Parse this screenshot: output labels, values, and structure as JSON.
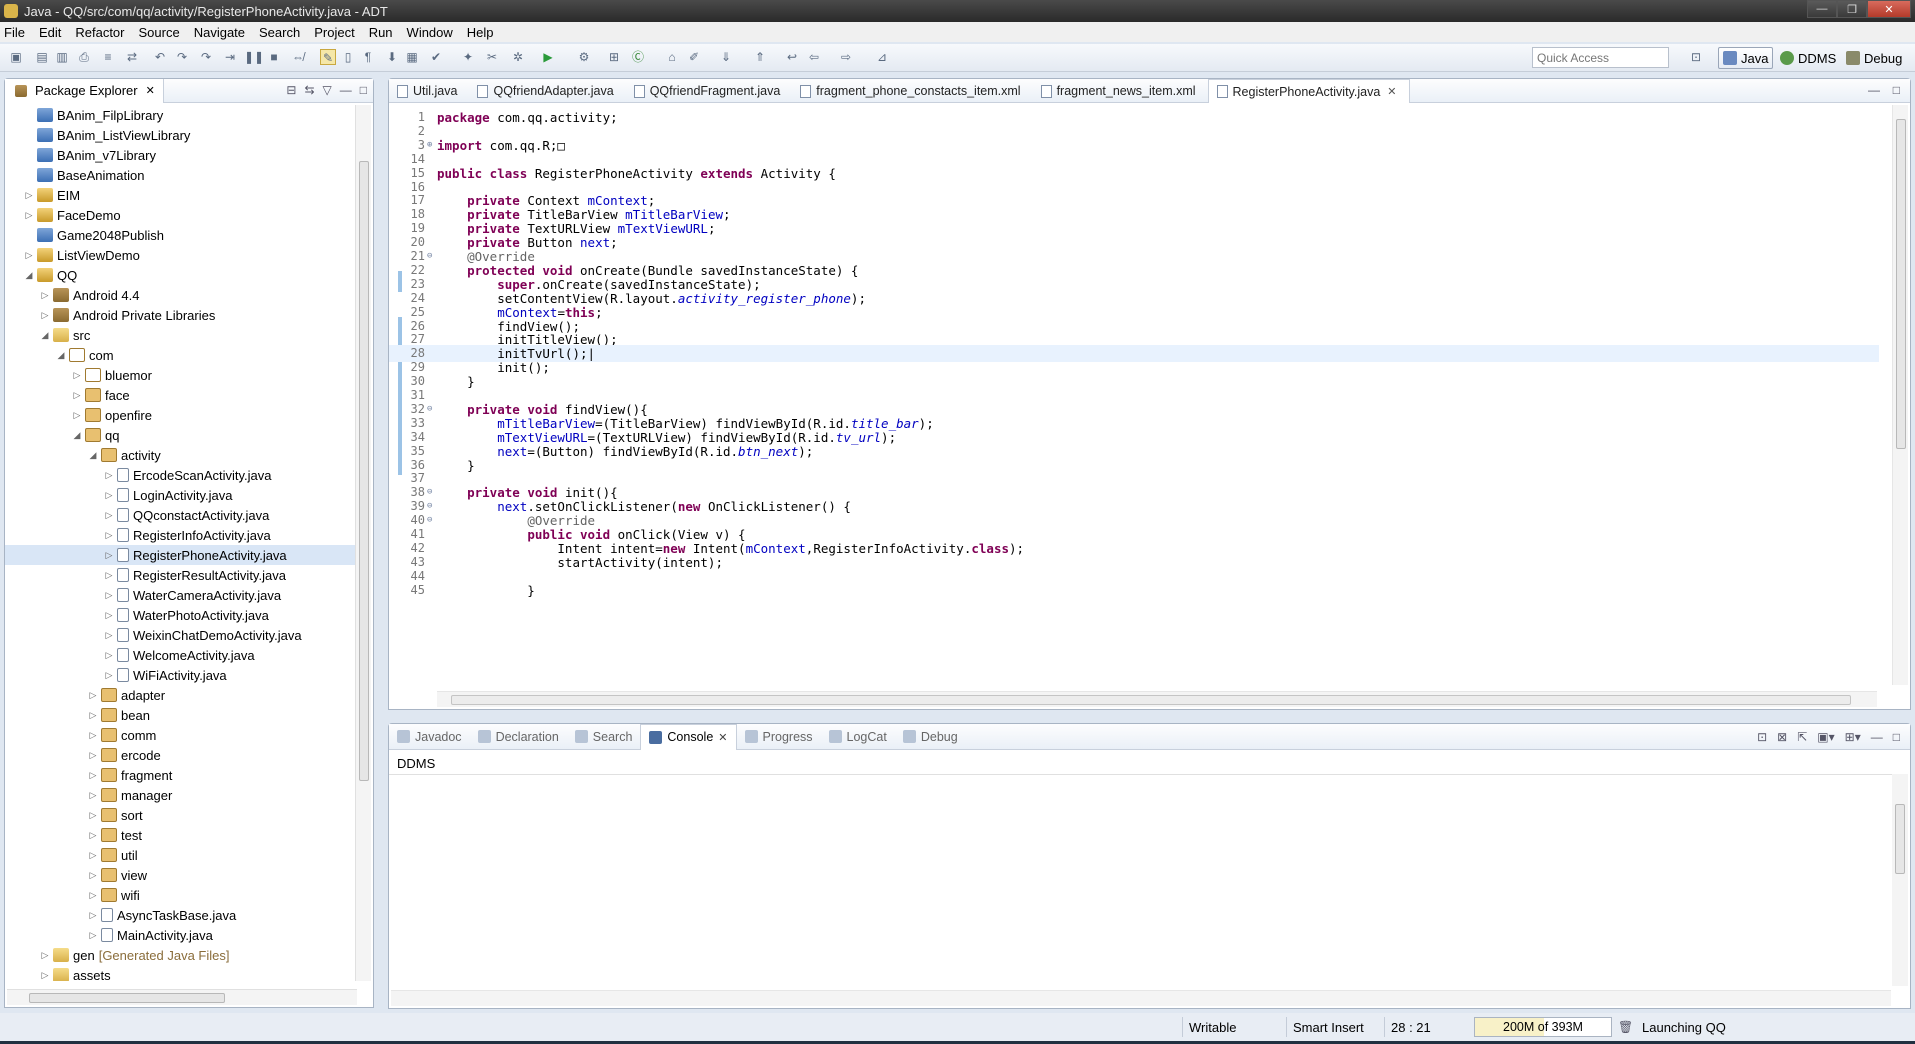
{
  "window": {
    "title": "Java - QQ/src/com/qq/activity/RegisterPhoneActivity.java - ADT",
    "minimize": "—",
    "maximize": "❐",
    "close": "✕"
  },
  "menu": [
    "File",
    "Edit",
    "Refactor",
    "Source",
    "Navigate",
    "Search",
    "Project",
    "Run",
    "Window",
    "Help"
  ],
  "toolbar": {
    "quick_access_placeholder": "Quick Access",
    "perspectives": [
      {
        "label": "Java",
        "active": true
      },
      {
        "label": "DDMS",
        "active": false
      },
      {
        "label": "Debug",
        "active": false
      }
    ]
  },
  "package_explorer": {
    "tab_label": "Package Explorer",
    "items": [
      {
        "label": "BAnim_FilpLibrary",
        "depth": 0,
        "icon": "project",
        "twisty": ""
      },
      {
        "label": "BAnim_ListViewLibrary",
        "depth": 0,
        "icon": "project",
        "twisty": ""
      },
      {
        "label": "BAnim_v7Library",
        "depth": 0,
        "icon": "project",
        "twisty": ""
      },
      {
        "label": "BaseAnimation",
        "depth": 0,
        "icon": "project",
        "twisty": ""
      },
      {
        "label": "EIM",
        "depth": 0,
        "icon": "projx",
        "twisty": "▷"
      },
      {
        "label": "FaceDemo",
        "depth": 0,
        "icon": "projx",
        "twisty": "▷"
      },
      {
        "label": "Game2048Publish",
        "depth": 0,
        "icon": "project",
        "twisty": ""
      },
      {
        "label": "ListViewDemo",
        "depth": 0,
        "icon": "projx",
        "twisty": "▷"
      },
      {
        "label": "QQ",
        "depth": 0,
        "icon": "projx",
        "twisty": "◢"
      },
      {
        "label": "Android 4.4",
        "depth": 1,
        "icon": "lib",
        "twisty": "▷"
      },
      {
        "label": "Android Private Libraries",
        "depth": 1,
        "icon": "lib",
        "twisty": "▷"
      },
      {
        "label": "src",
        "depth": 1,
        "icon": "folder",
        "twisty": "◢"
      },
      {
        "label": "com",
        "depth": 2,
        "icon": "pkgempty",
        "twisty": "◢"
      },
      {
        "label": "bluemor",
        "depth": 3,
        "icon": "pkgempty",
        "twisty": "▷"
      },
      {
        "label": "face",
        "depth": 3,
        "icon": "pkg",
        "twisty": "▷"
      },
      {
        "label": "openfire",
        "depth": 3,
        "icon": "pkg",
        "twisty": "▷"
      },
      {
        "label": "qq",
        "depth": 3,
        "icon": "pkg",
        "twisty": "◢"
      },
      {
        "label": "activity",
        "depth": 4,
        "icon": "pkg",
        "twisty": "◢"
      },
      {
        "label": "ErcodeScanActivity.java",
        "depth": 5,
        "icon": "java",
        "twisty": "▷"
      },
      {
        "label": "LoginActivity.java",
        "depth": 5,
        "icon": "java",
        "twisty": "▷"
      },
      {
        "label": "QQconstactActivity.java",
        "depth": 5,
        "icon": "java",
        "twisty": "▷"
      },
      {
        "label": "RegisterInfoActivity.java",
        "depth": 5,
        "icon": "java",
        "twisty": "▷"
      },
      {
        "label": "RegisterPhoneActivity.java",
        "depth": 5,
        "icon": "java",
        "twisty": "▷",
        "selected": true
      },
      {
        "label": "RegisterResultActivity.java",
        "depth": 5,
        "icon": "java",
        "twisty": "▷"
      },
      {
        "label": "WaterCameraActivity.java",
        "depth": 5,
        "icon": "java",
        "twisty": "▷"
      },
      {
        "label": "WaterPhotoActivity.java",
        "depth": 5,
        "icon": "java",
        "twisty": "▷"
      },
      {
        "label": "WeixinChatDemoActivity.java",
        "depth": 5,
        "icon": "java",
        "twisty": "▷"
      },
      {
        "label": "WelcomeActivity.java",
        "depth": 5,
        "icon": "java",
        "twisty": "▷"
      },
      {
        "label": "WiFiActivity.java",
        "depth": 5,
        "icon": "java",
        "twisty": "▷"
      },
      {
        "label": "adapter",
        "depth": 4,
        "icon": "pkg",
        "twisty": "▷"
      },
      {
        "label": "bean",
        "depth": 4,
        "icon": "pkg",
        "twisty": "▷"
      },
      {
        "label": "comm",
        "depth": 4,
        "icon": "pkg",
        "twisty": "▷"
      },
      {
        "label": "ercode",
        "depth": 4,
        "icon": "pkg",
        "twisty": "▷"
      },
      {
        "label": "fragment",
        "depth": 4,
        "icon": "pkg",
        "twisty": "▷"
      },
      {
        "label": "manager",
        "depth": 4,
        "icon": "pkg",
        "twisty": "▷"
      },
      {
        "label": "sort",
        "depth": 4,
        "icon": "pkg",
        "twisty": "▷"
      },
      {
        "label": "test",
        "depth": 4,
        "icon": "pkg",
        "twisty": "▷"
      },
      {
        "label": "util",
        "depth": 4,
        "icon": "pkg",
        "twisty": "▷"
      },
      {
        "label": "view",
        "depth": 4,
        "icon": "pkg",
        "twisty": "▷"
      },
      {
        "label": "wifi",
        "depth": 4,
        "icon": "pkg",
        "twisty": "▷"
      },
      {
        "label": "AsyncTaskBase.java",
        "depth": 4,
        "icon": "java",
        "twisty": "▷"
      },
      {
        "label": "MainActivity.java",
        "depth": 4,
        "icon": "java",
        "twisty": "▷"
      },
      {
        "label": "gen",
        "depth": 1,
        "icon": "folder",
        "twisty": "▷",
        "decoration": "[Generated Java Files]"
      },
      {
        "label": "assets",
        "depth": 1,
        "icon": "folder",
        "twisty": "▷"
      }
    ]
  },
  "editor": {
    "tabs": [
      {
        "label": "Util.java",
        "active": false
      },
      {
        "label": "QQfriendAdapter.java",
        "active": false
      },
      {
        "label": "QQfriendFragment.java",
        "active": false
      },
      {
        "label": "fragment_phone_constacts_item.xml",
        "active": false
      },
      {
        "label": "fragment_news_item.xml",
        "active": false
      },
      {
        "label": "RegisterPhoneActivity.java",
        "active": true
      }
    ],
    "current_line": 28,
    "lines": [
      {
        "n": "1",
        "fold": "",
        "html": "<span class='kw'>package</span> com.qq.activity;"
      },
      {
        "n": "2",
        "fold": "",
        "html": ""
      },
      {
        "n": "3",
        "fold": "⊕",
        "html": "<span class='kw'>import</span> com.qq.R;□"
      },
      {
        "n": "14",
        "fold": "",
        "html": ""
      },
      {
        "n": "15",
        "fold": "",
        "html": "<span class='kw'>public class</span> RegisterPhoneActivity <span class='kw'>extends</span> Activity {"
      },
      {
        "n": "16",
        "fold": "",
        "html": ""
      },
      {
        "n": "17",
        "fold": "",
        "html": "    <span class='kw'>private</span> Context <span class='fld'>mContext</span>;"
      },
      {
        "n": "18",
        "fold": "",
        "html": "    <span class='kw'>private</span> TitleBarView <span class='fld'>mTitleBarView</span>;"
      },
      {
        "n": "19",
        "fold": "",
        "html": "    <span class='kw'>private</span> TextURLView <span class='fld'>mTextViewURL</span>;"
      },
      {
        "n": "20",
        "fold": "",
        "html": "    <span class='kw'>private</span> Button <span class='fld'>next</span>;"
      },
      {
        "n": "21",
        "fold": "⊖",
        "html": "    <span class='ann'>@Override</span>"
      },
      {
        "n": "22",
        "fold": "",
        "html": "    <span class='kw'>protected void</span> onCreate(Bundle savedInstanceState) {"
      },
      {
        "n": "23",
        "fold": "",
        "html": "        <span class='kw'>super</span>.onCreate(savedInstanceState);"
      },
      {
        "n": "24",
        "fold": "",
        "html": "        setContentView(R.layout.<span class='fld it'>activity_register_phone</span>);"
      },
      {
        "n": "25",
        "fold": "",
        "html": "        <span class='fld'>mContext</span>=<span class='kw'>this</span>;"
      },
      {
        "n": "26",
        "fold": "",
        "html": "        findView();"
      },
      {
        "n": "27",
        "fold": "",
        "html": "        initTitleView();"
      },
      {
        "n": "28",
        "fold": "",
        "html": "        initTvUrl();|"
      },
      {
        "n": "29",
        "fold": "",
        "html": "        init();"
      },
      {
        "n": "30",
        "fold": "",
        "html": "    }"
      },
      {
        "n": "31",
        "fold": "",
        "html": ""
      },
      {
        "n": "32",
        "fold": "⊖",
        "html": "    <span class='kw'>private void</span> findView(){"
      },
      {
        "n": "33",
        "fold": "",
        "html": "        <span class='fld'>mTitleBarView</span>=(TitleBarView) findViewById(R.id.<span class='fld it'>title_bar</span>);"
      },
      {
        "n": "34",
        "fold": "",
        "html": "        <span class='fld'>mTextViewURL</span>=(TextURLView) findViewById(R.id.<span class='fld it'>tv_url</span>);"
      },
      {
        "n": "35",
        "fold": "",
        "html": "        <span class='fld'>next</span>=(Button) findViewById(R.id.<span class='fld it'>btn_next</span>);"
      },
      {
        "n": "36",
        "fold": "",
        "html": "    }"
      },
      {
        "n": "37",
        "fold": "",
        "html": ""
      },
      {
        "n": "38",
        "fold": "⊖",
        "html": "    <span class='kw'>private void</span> init(){"
      },
      {
        "n": "39",
        "fold": "⊖",
        "html": "        <span class='fld'>next</span>.setOnClickListener(<span class='kw'>new</span> OnClickListener() {"
      },
      {
        "n": "40",
        "fold": "⊖",
        "html": "            <span class='ann'>@Override</span>"
      },
      {
        "n": "41",
        "fold": "",
        "html": "            <span class='kw'>public void</span> onClick(View v) {"
      },
      {
        "n": "42",
        "fold": "",
        "html": "                Intent intent=<span class='kw'>new</span> Intent(<span class='fld'>mContext</span>,RegisterInfoActivity.<span class='kw'>class</span>);"
      },
      {
        "n": "43",
        "fold": "",
        "html": "                startActivity(intent);"
      },
      {
        "n": "44",
        "fold": "",
        "html": ""
      },
      {
        "n": "45",
        "fold": "",
        "html": "            }"
      }
    ]
  },
  "bottom_panel": {
    "tabs": [
      {
        "label": "Javadoc",
        "active": false
      },
      {
        "label": "Declaration",
        "active": false
      },
      {
        "label": "Search",
        "active": false
      },
      {
        "label": "Console",
        "active": true
      },
      {
        "label": "Progress",
        "active": false
      },
      {
        "label": "LogCat",
        "active": false
      },
      {
        "label": "Debug",
        "active": false
      }
    ],
    "console_name": "DDMS"
  },
  "status_bar": {
    "writable": "Writable",
    "insert_mode": "Smart Insert",
    "position": "28 : 21",
    "heap_text": "200M of 393M",
    "heap_used_fraction": 0.51,
    "task": "Launching QQ"
  }
}
